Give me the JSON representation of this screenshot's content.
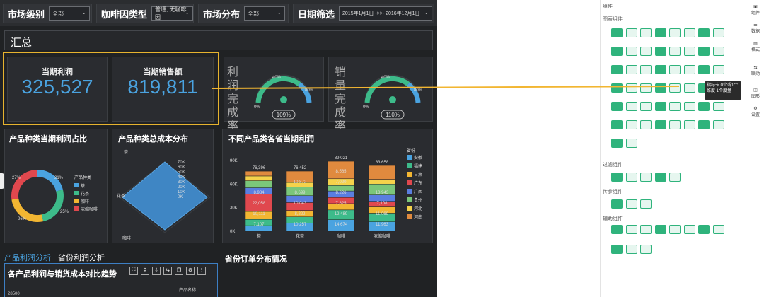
{
  "filters": [
    {
      "label": "市场级别",
      "value": "全部"
    },
    {
      "label": "咖啡因类型",
      "value": "普通, 无咖啡因"
    },
    {
      "label": "市场分布",
      "value": "全部"
    },
    {
      "label": "日期筛选",
      "value": "2015年1月1日 ->>- 2016年12月1日"
    }
  ],
  "summary_title": "汇总",
  "kpis": [
    {
      "title": "当期利润",
      "value": "325,527"
    },
    {
      "title": "当期销售额",
      "value": "819,811"
    }
  ],
  "gauges": [
    {
      "label": "利润完成率",
      "value_text": "109%",
      "min": "0%",
      "mid": "40%",
      "max": "80%",
      "fraction": 0.55
    },
    {
      "label": "销量完成率",
      "value_text": "110%",
      "min": "0%",
      "mid": "40%",
      "max": "80%",
      "fraction": 0.55
    }
  ],
  "donut": {
    "title": "产品种类当期利润占比",
    "legend_title": "产品种类",
    "slices": [
      {
        "name": "茶",
        "pct": 21,
        "color": "#4aa3e0"
      },
      {
        "name": "花茶",
        "pct": 25,
        "color": "#3dbb8a"
      },
      {
        "name": "咖啡",
        "pct": 26,
        "color": "#f2b632"
      },
      {
        "name": "浓缩咖啡",
        "pct": 27,
        "color": "#e0484e"
      }
    ],
    "labels": [
      "27%",
      "21%",
      "25%",
      "26%"
    ]
  },
  "radar": {
    "title": "产品种类总成本分布",
    "ticks": [
      "70K",
      "60K",
      "50K",
      "40K",
      "30K",
      "20K",
      "10K",
      "0K"
    ],
    "axes": [
      "茶",
      "花茶",
      "咖啡",
      ".."
    ]
  },
  "chart_data": {
    "type": "bar",
    "title": "不同产品类各省当期利润",
    "categories": [
      "茶",
      "花茶",
      "咖啡",
      "浓缩咖啡"
    ],
    "totals": [
      "76,396",
      "76,452",
      "89,021",
      "83,658"
    ],
    "yticks": [
      "90K",
      "60K",
      "30K",
      "0K"
    ],
    "ylim": [
      0,
      90000
    ],
    "legend_title": "省份",
    "series": [
      {
        "name": "安徽",
        "color": "#4aa3e0",
        "values": [
          7107,
          10257,
          14674,
          11963
        ]
      },
      {
        "name": "福建",
        "color": "#3dbb8a",
        "values": [
          8000,
          8000,
          12489,
          11069
        ]
      },
      {
        "name": "甘肃",
        "color": "#f2b632",
        "values": [
          10111,
          8222,
          8000,
          8000
        ]
      },
      {
        "name": "广东",
        "color": "#e0484e",
        "values": [
          22058,
          10043,
          7825,
          7108
        ]
      },
      {
        "name": "广西",
        "color": "#5a7ee0",
        "values": [
          8000,
          8699,
          8226,
          8000
        ]
      },
      {
        "name": "贵州",
        "color": "#7bc67a",
        "values": [
          8984,
          10872,
          7020,
          13943
        ]
      },
      {
        "name": "河北",
        "color": "#f5d24b",
        "values": [
          6000,
          6000,
          8565,
          6000
        ]
      },
      {
        "name": "河南",
        "color": "#e08a3e",
        "values": [
          6136,
          14359,
          22222,
          17575
        ]
      }
    ],
    "labels": [
      [
        "7,107",
        "10,111",
        "22,058",
        "8,984"
      ],
      [
        "10,257",
        "8,222",
        "10,043",
        "8,699",
        "10,872"
      ],
      [
        "14,674",
        "12,489",
        "7,825",
        "8,226",
        "7,020",
        "8,565"
      ],
      [
        "11,963",
        "11,069",
        "7,108",
        "13,943"
      ]
    ]
  },
  "tabs": [
    "产品利润分析",
    "省份利润分析"
  ],
  "section2": "省份订单分布情况",
  "trend": {
    "title": "各产品利润与销货成本对比趋势",
    "ytick": "28500",
    "legend": "产品名称"
  },
  "panel": {
    "header": "组件",
    "chart_section": "图表组件",
    "tooltip": "指标卡 0个或1个维度 1个度量",
    "filter_section": "过滤组件",
    "param_section": "传参组件",
    "aux_section": "辅助组件"
  },
  "right_strip": [
    "组件",
    "数据",
    "格式",
    "联动",
    "图形",
    "设置"
  ]
}
